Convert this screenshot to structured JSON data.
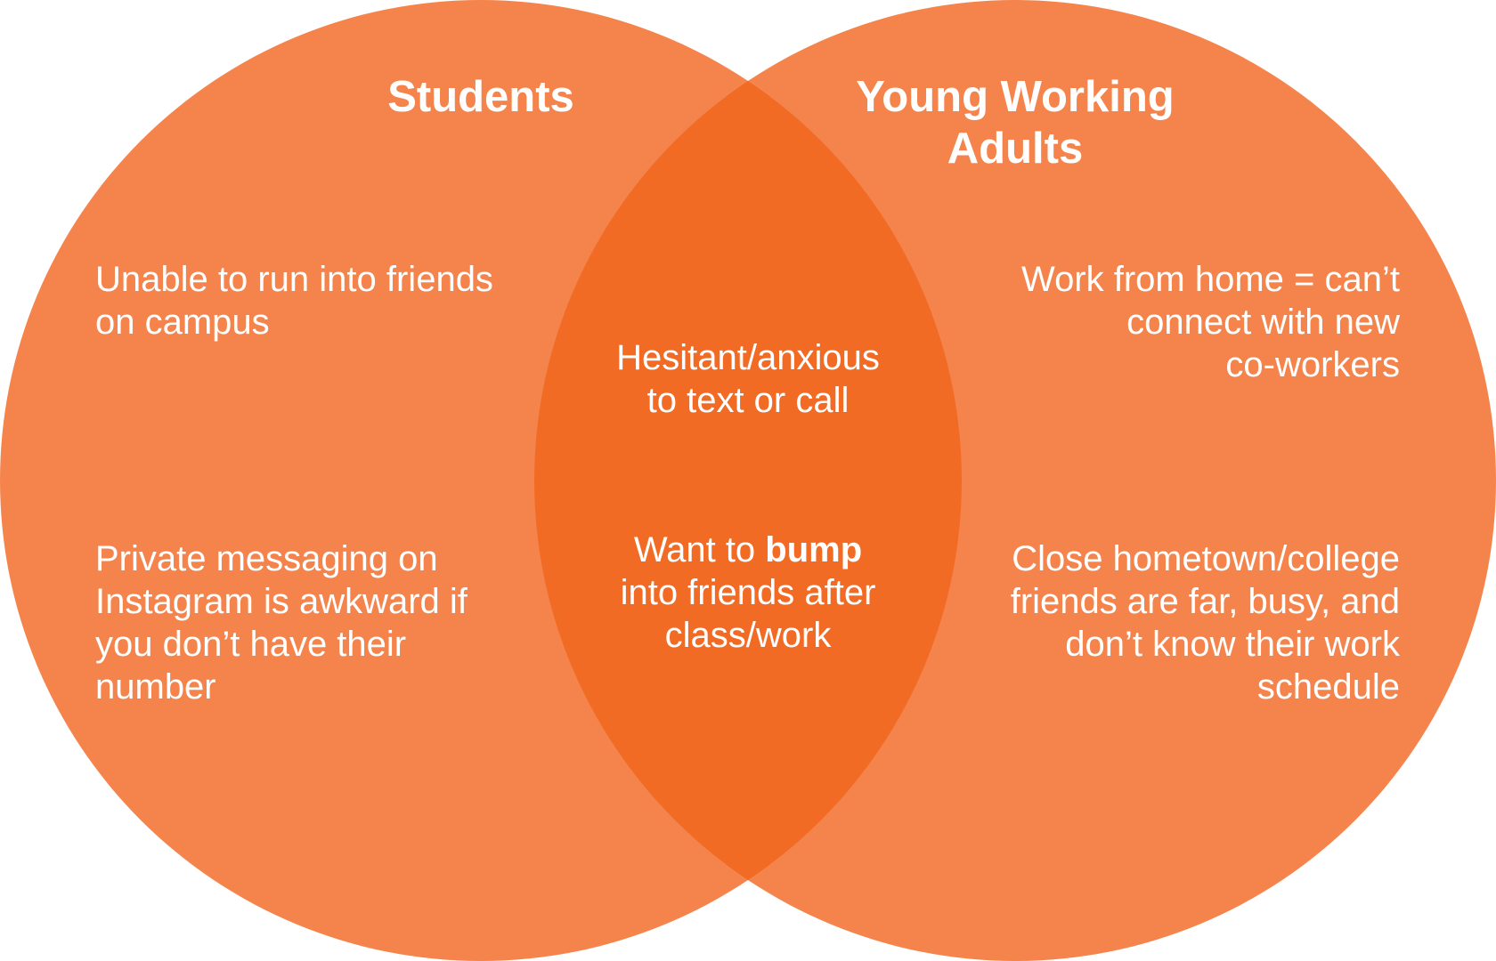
{
  "colors": {
    "circle_fill": "#f4844b",
    "overlap_fill": "#f26b25",
    "text": "#ffffff"
  },
  "left_set": {
    "title": "Students",
    "items": [
      "Unable to run into friends\non campus",
      "Private messaging on\nInstagram is awkward if\nyou don’t have their\nnumber"
    ]
  },
  "right_set": {
    "title": "Young Working\nAdults",
    "items": [
      "Work from home = can’t\nconnect with new\nco-workers",
      "Close hometown/college\nfriends are far, busy, and\ndon’t know their work\nschedule"
    ]
  },
  "intersection": {
    "item_1": "Hesitant/anxious\nto text or call",
    "item_2": {
      "prefix": "Want to ",
      "emphasis": "bump",
      "suffix": "\ninto friends after\nclass/work"
    }
  }
}
